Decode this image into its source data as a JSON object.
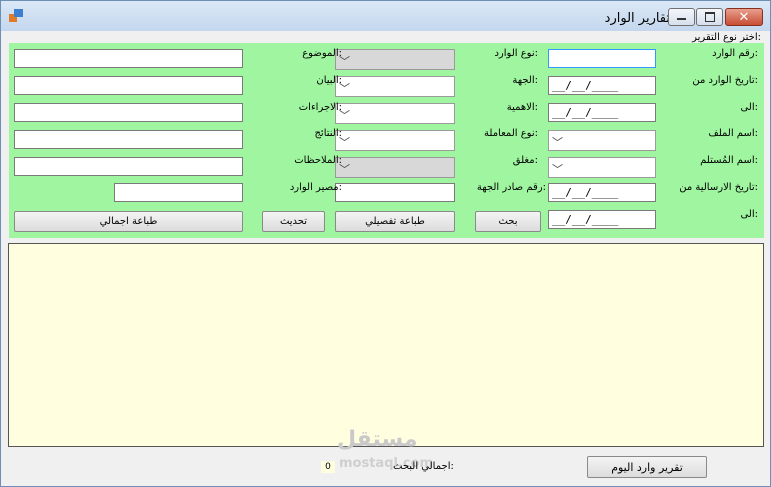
{
  "window": {
    "title": "تقارير الوارد"
  },
  "report_type_label": "اختر نوع التقرير:",
  "fields": {
    "incoming_number": "رقم الوارد:",
    "incoming_type": "نوع الوارد:",
    "subject": "الموضوع:",
    "incoming_date_from": "تاريخ الوارد من:",
    "entity": "الجهة:",
    "statement": "البيان:",
    "to1": "الى:",
    "importance": "الاهمية:",
    "actions": "الاجراءات:",
    "file_name": "اسم الملف:",
    "transaction_type": "نوع المعاملة:",
    "results": "النتائج:",
    "receiver_name": "اسم المُستلم:",
    "closed": "مغلق:",
    "notes": "الملاحظات:",
    "send_date_from": "تاريخ الارسالية من:",
    "entity_issued_number": "رقم صادر الجهة:",
    "incoming_fate": "مصير الوارد:",
    "to2": "الى:"
  },
  "date_placeholder": "__/__/____",
  "buttons": {
    "search": "بحث",
    "print_detailed": "طباعة تفصيلي",
    "refresh": "تحديث",
    "print_total": "طباعة اجمالي",
    "today_report": "تقرير وارد اليوم"
  },
  "footer": {
    "total_label": "اجمالي البحث:",
    "total_value": "0"
  },
  "watermark": {
    "brand_ar": "مستقل",
    "brand_en": "mostaql.com"
  }
}
